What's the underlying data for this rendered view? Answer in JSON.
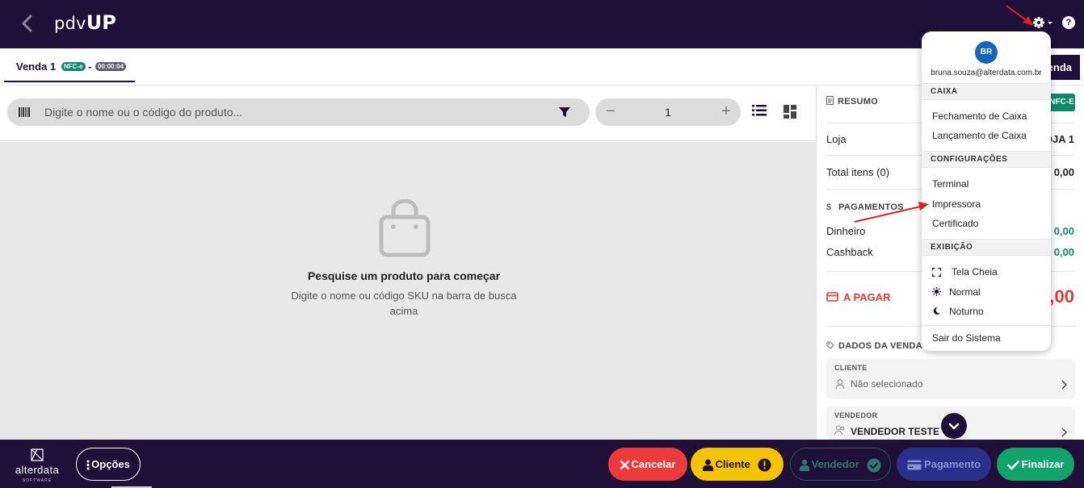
{
  "app": {
    "logo_light": "pdv",
    "logo_bold": "UP",
    "help_label": "?"
  },
  "tab": {
    "label": "Venda 1",
    "badge": "NFC-e",
    "dash": "-",
    "timer": "00:00:04",
    "new_sale_label": "enda"
  },
  "search": {
    "placeholder": "Digite o nome ou o código do produto...",
    "value": ""
  },
  "quantity": {
    "minus": "−",
    "value": "1",
    "plus": "+"
  },
  "empty": {
    "title": "Pesquise um produto para começar",
    "subtitle": "Digite o nome ou código SKU na barra de busca acima"
  },
  "summary": {
    "heading": "RESUMO",
    "doc_tag": "NFC-E",
    "store_label": "Loja",
    "store_value": "OJA 1",
    "items_label": "Total itens (0)",
    "items_value": "0,00",
    "payments_heading": "PAGAMENTOS",
    "payments": [
      {
        "label": "Dinheiro",
        "value": "0,00"
      },
      {
        "label": "Cashback",
        "value": "0,00"
      }
    ],
    "to_pay_label": "A PAGAR",
    "to_pay_value": ",00",
    "sale_data_heading": "DADOS DA VENDA",
    "client_caption": "CLIENTE",
    "client_value": "Não selecionado",
    "seller_caption": "VENDEDOR",
    "seller_value": "VENDEDOR TESTE"
  },
  "menu": {
    "avatar": "BR",
    "email": "bruna.souza@alterdata.com.br",
    "sections": [
      {
        "title": "CAIXA",
        "items": [
          "Fechamento de Caixa",
          "Lançamento de Caixa"
        ]
      },
      {
        "title": "CONFIGURAÇÕES",
        "items": [
          "Terminal",
          "Impressora",
          "Certificado"
        ]
      },
      {
        "title": "EXIBIÇÃO",
        "items": [
          "Tela Cheia",
          "Normal",
          "Noturno"
        ]
      }
    ],
    "logout": "Sair do Sistema"
  },
  "bottom": {
    "brand": "alterdata",
    "brand_sub": "SOFTWARE",
    "options": "Opções",
    "cancel": "Cancelar",
    "client": "Cliente",
    "seller": "Vendedor",
    "payment": "Pagamento",
    "finish": "Finalizar"
  },
  "colors": {
    "primary": "#1e1038",
    "success": "#0e8a6b",
    "danger": "#ef3a3a",
    "warning": "#f5c400",
    "annotation": "#e02020"
  }
}
